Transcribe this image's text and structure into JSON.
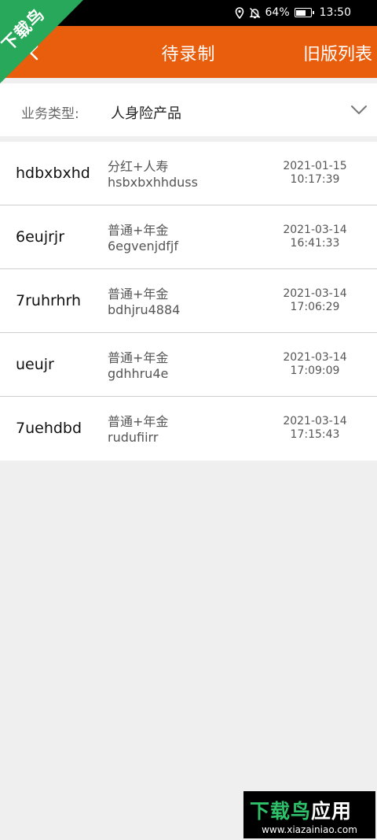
{
  "status_bar": {
    "battery": "64%",
    "time": "13:50"
  },
  "header": {
    "title": "待录制",
    "right_link": "旧版列表"
  },
  "filter": {
    "label": "业务类型:",
    "value": "人身险产品"
  },
  "records": [
    {
      "name": "hdbxbxhd",
      "type": "分红+人寿",
      "code": "hsbxbxhhduss",
      "date": "2021-01-15",
      "time": "10:17:39"
    },
    {
      "name": "6eujrjr",
      "type": "普通+年金",
      "code": "6egvenjdfjf",
      "date": "2021-03-14",
      "time": "16:41:33"
    },
    {
      "name": "7ruhrhrh",
      "type": "普通+年金",
      "code": "bdhjru4884",
      "date": "2021-03-14",
      "time": "17:06:29"
    },
    {
      "name": "ueujr",
      "type": "普通+年金",
      "code": "gdhhru4e",
      "date": "2021-03-14",
      "time": "17:09:09"
    },
    {
      "name": "7uehdbd",
      "type": "普通+年金",
      "code": "rudufiirr",
      "date": "2021-03-14",
      "time": "17:15:43"
    }
  ],
  "watermark": {
    "corner_text": "下载鸟",
    "bottom_main": "下载鸟",
    "bottom_suffix": "应用",
    "bottom_url": "www.xiazainiao.com"
  },
  "colors": {
    "accent": "#e85e0d",
    "watermark_green": "#27a85a"
  }
}
